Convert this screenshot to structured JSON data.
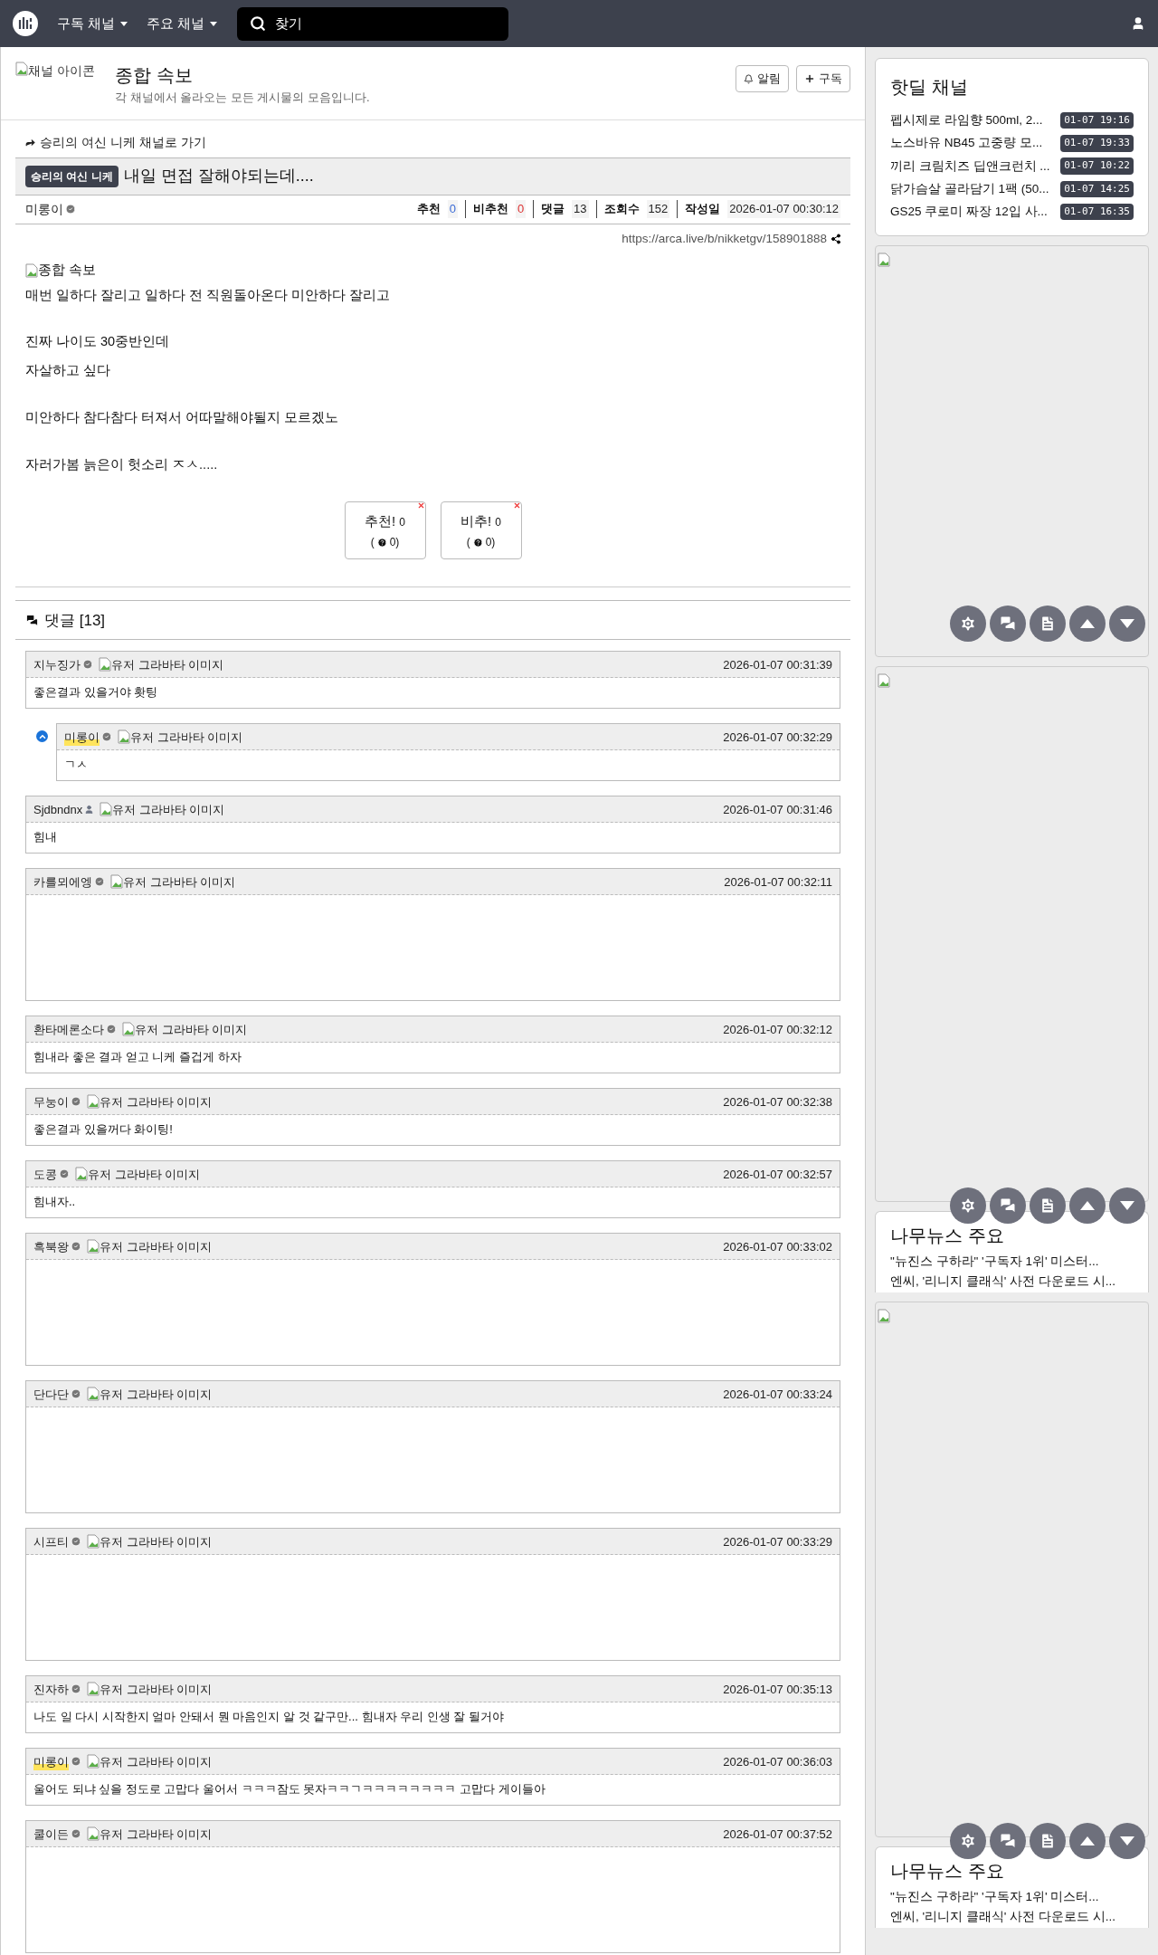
{
  "nav": {
    "menus": [
      {
        "label": "구독 채널"
      },
      {
        "label": "주요 채널"
      }
    ],
    "search": {
      "placeholder": "찾기"
    }
  },
  "channel": {
    "icon_alt": "채널 아이콘",
    "title": "종합 속보",
    "description": "각 채널에서 올라오는 모든 게시물의 모음입니다.",
    "buttons": [
      {
        "kind": "bell",
        "label": "알림"
      },
      {
        "kind": "plus",
        "label": "구독"
      }
    ]
  },
  "post": {
    "breadcrumb": "승리의 여신 니케 채널로 가기",
    "category": "승리의 여신 니케",
    "title": "내일 면접 잘해야되는데....",
    "author": "미롱이",
    "stats": [
      {
        "label": "추천",
        "value": "0",
        "kind": "up"
      },
      {
        "label": "비추천",
        "value": "0",
        "kind": "down"
      },
      {
        "label": "댓글",
        "value": "13",
        "kind": "plain"
      },
      {
        "label": "조회수",
        "value": "152",
        "kind": "plain"
      },
      {
        "label": "작성일",
        "value": "2026-01-07 00:30:12",
        "kind": "plain"
      }
    ],
    "url": "https://arca.live/b/nikketgv/158901888",
    "image_alt": "종합 속보",
    "body": [
      [
        "매번 일하다 잘리고 일하다 전 직원돌아온다 미안하다 잘리고"
      ],
      [
        "진짜 나이도 30중반인데",
        "자살하고 싶다"
      ],
      [
        "미안하다 참다참다 터져서 어따말해야될지 모르겠노"
      ],
      [
        "자러가봄 늙은이 헛소리 ㅈㅅ....."
      ]
    ],
    "votes": [
      {
        "label": "추천!",
        "count": "0",
        "sub_open": "(",
        "sub_count": "0)"
      },
      {
        "label": "비추!",
        "count": "0",
        "sub_open": "(",
        "sub_count": "0)"
      }
    ]
  },
  "comments_header": "댓글 [13]",
  "comments": [
    {
      "author": "지누징가",
      "verified": true,
      "is_op": false,
      "avatar_alt": "유저 그라바타 이미지",
      "time": "2026-01-07 00:31:39",
      "kind": "text",
      "body": "좋은결과 있을거야 홧팅",
      "children": [
        {
          "author": "미롱이",
          "verified": true,
          "is_op": true,
          "avatar_alt": "유저 그라바타 이미지",
          "time": "2026-01-07 00:32:29",
          "kind": "text",
          "body": "ㄱㅅ"
        }
      ]
    },
    {
      "author": "Sjdbndnx",
      "verified": false,
      "is_op": false,
      "avatar_alt": "유저 그라바타 이미지",
      "time": "2026-01-07 00:31:46",
      "kind": "text",
      "body": "힘내"
    },
    {
      "author": "카를뫼에엥",
      "verified": true,
      "is_op": false,
      "avatar_alt": "유저 그라바타 이미지",
      "time": "2026-01-07 00:32:11",
      "kind": "sticker"
    },
    {
      "author": "환타메론소다",
      "verified": true,
      "is_op": false,
      "avatar_alt": "유저 그라바타 이미지",
      "time": "2026-01-07 00:32:12",
      "kind": "text",
      "body": "힘내라 좋은 결과 얻고 니케 즐겁게 하자"
    },
    {
      "author": "무눙이",
      "verified": true,
      "is_op": false,
      "avatar_alt": "유저 그라바타 이미지",
      "time": "2026-01-07 00:32:38",
      "kind": "text",
      "body": "좋은결과 있을꺼다 화이팅!"
    },
    {
      "author": "도콩",
      "verified": true,
      "is_op": false,
      "avatar_alt": "유저 그라바타 이미지",
      "time": "2026-01-07 00:32:57",
      "kind": "text",
      "body": "힘내자.."
    },
    {
      "author": "흑북왕",
      "verified": true,
      "is_op": false,
      "avatar_alt": "유저 그라바타 이미지",
      "time": "2026-01-07 00:33:02",
      "kind": "sticker"
    },
    {
      "author": "단다단",
      "verified": true,
      "is_op": false,
      "avatar_alt": "유저 그라바타 이미지",
      "time": "2026-01-07 00:33:24",
      "kind": "sticker"
    },
    {
      "author": "시프티",
      "verified": true,
      "is_op": false,
      "avatar_alt": "유저 그라바타 이미지",
      "time": "2026-01-07 00:33:29",
      "kind": "sticker"
    },
    {
      "author": "진자하",
      "verified": true,
      "is_op": false,
      "avatar_alt": "유저 그라바타 이미지",
      "time": "2026-01-07 00:35:13",
      "kind": "text",
      "body": "나도 일 다시 시작한지 얼마 안돼서 뭔 마음인지 알 것 같구만... 힘내자 우리 인생 잘 될거야"
    },
    {
      "author": "미롱이",
      "verified": true,
      "is_op": true,
      "avatar_alt": "유저 그라바타 이미지",
      "time": "2026-01-07 00:36:03",
      "kind": "text",
      "body": "울어도 되냐 싶을 정도로 고맙다 울어서 ㅋㅋㅋ잠도 못자ㅋㅋㄱㅋㅋㅋㅋㅋㅋㅋㅋ 고맙다 게이들아"
    },
    {
      "author": "쿨이든",
      "verified": true,
      "is_op": false,
      "avatar_alt": "유저 그라바타 이미지",
      "time": "2026-01-07 00:37:52",
      "kind": "sticker"
    }
  ],
  "sidebar": [
    {
      "kind": "list",
      "title": "핫딜 채널",
      "items": [
        {
          "text": "펩시제로 라임향 500ml, 2...",
          "time": "01-07 19:16"
        },
        {
          "text": "노스바유 NB45 고중량 모...",
          "time": "01-07 19:33"
        },
        {
          "text": "끼리 크림치즈 딥앤크런치 ...",
          "time": "01-07 10:22"
        },
        {
          "text": "닭가슴살 골라담기 1팩 (50...",
          "time": "01-07 14:25"
        },
        {
          "text": "GS25 쿠로미 짜장 12입 사...",
          "time": "01-07 16:35"
        }
      ]
    },
    {
      "kind": "short_ad",
      "floating": true
    },
    {
      "kind": "tall_ad",
      "floating": false
    },
    {
      "kind": "news",
      "title": "나무뉴스 주요",
      "lines": [
        "\"뉴진스 구하라\" '구독자 1위' 미스터...",
        "엔씨, '리니지 클래식' 사전 다운로드 시..."
      ],
      "floating": true
    },
    {
      "kind": "tall_ad",
      "floating": false
    },
    {
      "kind": "news",
      "title": "나무뉴스 주요",
      "lines": [
        "\"뉴진스 구하라\" '구독자 1위' 미스터...",
        "엔씨, '리니지 클래식' 사전 다운로드 시..."
      ],
      "floating": true
    }
  ]
}
